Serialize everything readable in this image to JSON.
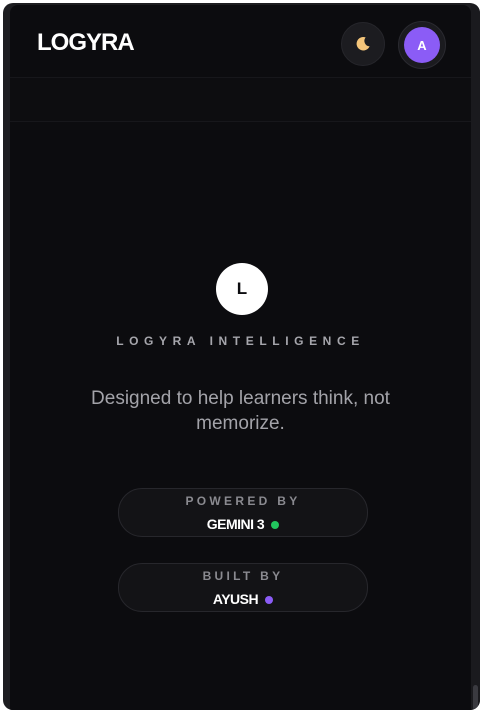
{
  "header": {
    "logo": "LOGYRA",
    "theme_icon": "moon-icon",
    "avatar_initial": "A"
  },
  "hero": {
    "badge_letter": "L",
    "brand_title": "LOGYRA INTELLIGENCE",
    "tagline": "Designed to help learners think, not memorize."
  },
  "powered": {
    "label": "POWERED BY",
    "value": "GEMINI 3",
    "dot_color": "#22c55e"
  },
  "built": {
    "label": "BUILT BY",
    "value": "AYUSH",
    "dot_color": "#8b5cf6"
  },
  "colors": {
    "accent": "#8b5cf6",
    "background": "#0c0c0f",
    "status_green": "#22c55e"
  }
}
